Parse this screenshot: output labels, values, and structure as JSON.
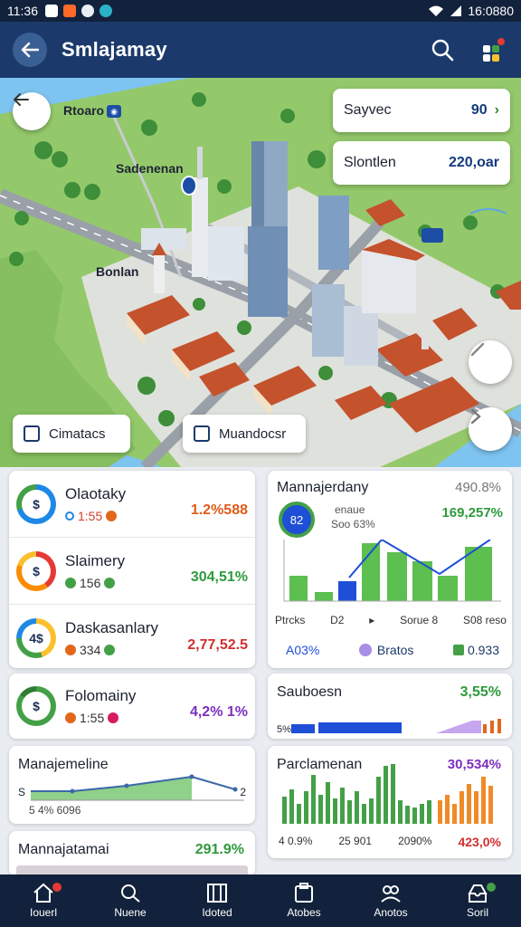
{
  "status": {
    "time": "11:36",
    "right_text": "16:0880"
  },
  "appbar": {
    "title": "Smlajamay"
  },
  "map": {
    "labels": {
      "top": "Rtoaro",
      "mid": "Sadenenan",
      "low": "Bonlan"
    },
    "cards": [
      {
        "label": "Sayvec",
        "value": "90"
      },
      {
        "label": "Slontlen",
        "value": "220,oar"
      }
    ],
    "pills": [
      {
        "label": "Cimatacs"
      },
      {
        "label": "Muandocsr"
      }
    ]
  },
  "list_items": [
    {
      "title": "Olaotaky",
      "sub": "1:55",
      "value": "1.2%588",
      "ring_colors": [
        "#1e88e5",
        "#43a047"
      ],
      "dot": "#e2671b",
      "value_color": "#e05a1a"
    },
    {
      "title": "Slaimery",
      "sub": "156",
      "value": "304,51%",
      "ring_colors": [
        "#e53935",
        "#fb8c00"
      ],
      "dot": "#43a047",
      "value_color": "#2e9a3c"
    },
    {
      "title": "Daskasanlary",
      "sub": "334",
      "value": "2,77,52.5",
      "ring_colors": [
        "#fbc02d",
        "#43a047"
      ],
      "dot": "#e2671b",
      "value_color": "#d12f2f"
    },
    {
      "title": "Folomainy",
      "sub": "1:55",
      "value": "4,2% 1%",
      "ring_colors": [
        "#43a047",
        "#2e7d32"
      ],
      "dot": "#e2671b",
      "value_color": "#7b2fbf"
    }
  ],
  "management_card": {
    "title": "Manajemeline",
    "value_left": "S",
    "value_right": "2",
    "sub": "5 4% 6096"
  },
  "management_card2": {
    "title": "Mannajatamai",
    "value": "291.9%"
  },
  "chart_card": {
    "title": "Mannajerdany",
    "value": "490.8%",
    "inner_title": "enaue",
    "inner_sub": "Soo 63%",
    "green_value": "169,257%",
    "legend": [
      "Ptrcks",
      "D2",
      "Sorue 8",
      "S08 reso"
    ],
    "footer": [
      "A03%",
      "Bratos",
      "0.933"
    ]
  },
  "sauboesn": {
    "title": "Sauboesn",
    "value": "3,55%",
    "axis": "5%"
  },
  "parclamenan": {
    "title": "Parclamenan",
    "value": "30,534%",
    "footer": [
      "4 0.9%",
      "25 901",
      "2090%",
      "423,0%"
    ]
  },
  "nav": [
    {
      "label": "Iouerl"
    },
    {
      "label": "Nuene"
    },
    {
      "label": "Idoted"
    },
    {
      "label": "Atobes"
    },
    {
      "label": "Anotos"
    },
    {
      "label": "Soril"
    }
  ],
  "colors": {
    "primary": "#1b3a6b",
    "dark": "#12223c",
    "green": "#43a047",
    "blue": "#1e4fd6"
  }
}
